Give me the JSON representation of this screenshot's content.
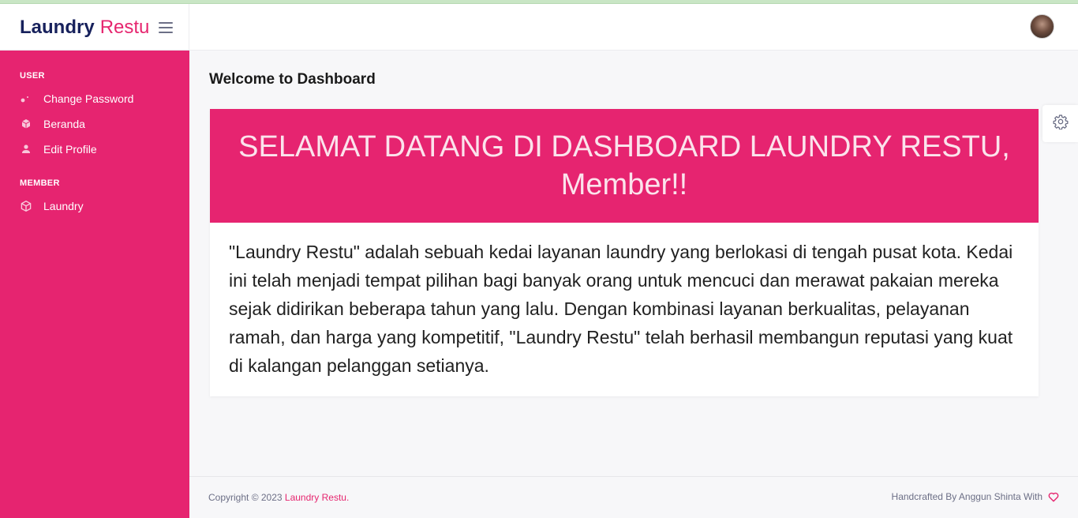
{
  "brand": {
    "name": "Laundry",
    "suffix": "Restu"
  },
  "sidebar": {
    "sections": [
      {
        "title": "USER",
        "items": [
          {
            "label": "Change Password",
            "icon": "dots-icon"
          },
          {
            "label": "Beranda",
            "icon": "cube-icon"
          },
          {
            "label": "Edit Profile",
            "icon": "user-icon"
          }
        ]
      },
      {
        "title": "MEMBER",
        "items": [
          {
            "label": "Laundry",
            "icon": "box-icon"
          }
        ]
      }
    ]
  },
  "main": {
    "page_title": "Welcome to Dashboard",
    "banner_title": "SELAMAT DATANG DI DASHBOARD LAUNDRY RESTU, Member!!",
    "description": "\"Laundry Restu\" adalah sebuah kedai layanan laundry yang berlokasi di tengah pusat kota. Kedai ini telah menjadi tempat pilihan bagi banyak orang untuk mencuci dan merawat pakaian mereka sejak didirikan beberapa tahun yang lalu. Dengan kombinasi layanan berkualitas, pelayanan ramah, dan harga yang kompetitif, \"Laundry Restu\" telah berhasil membangun reputasi yang kuat di kalangan pelanggan setianya."
  },
  "footer": {
    "copyright_prefix": "Copyright © 2023",
    "copyright_brand": "Laundry Restu.",
    "credit": "Handcrafted By Anggun Shinta With"
  },
  "colors": {
    "accent": "#e62470",
    "brand_dark": "#17215c",
    "text_muted": "#6c6f86"
  }
}
